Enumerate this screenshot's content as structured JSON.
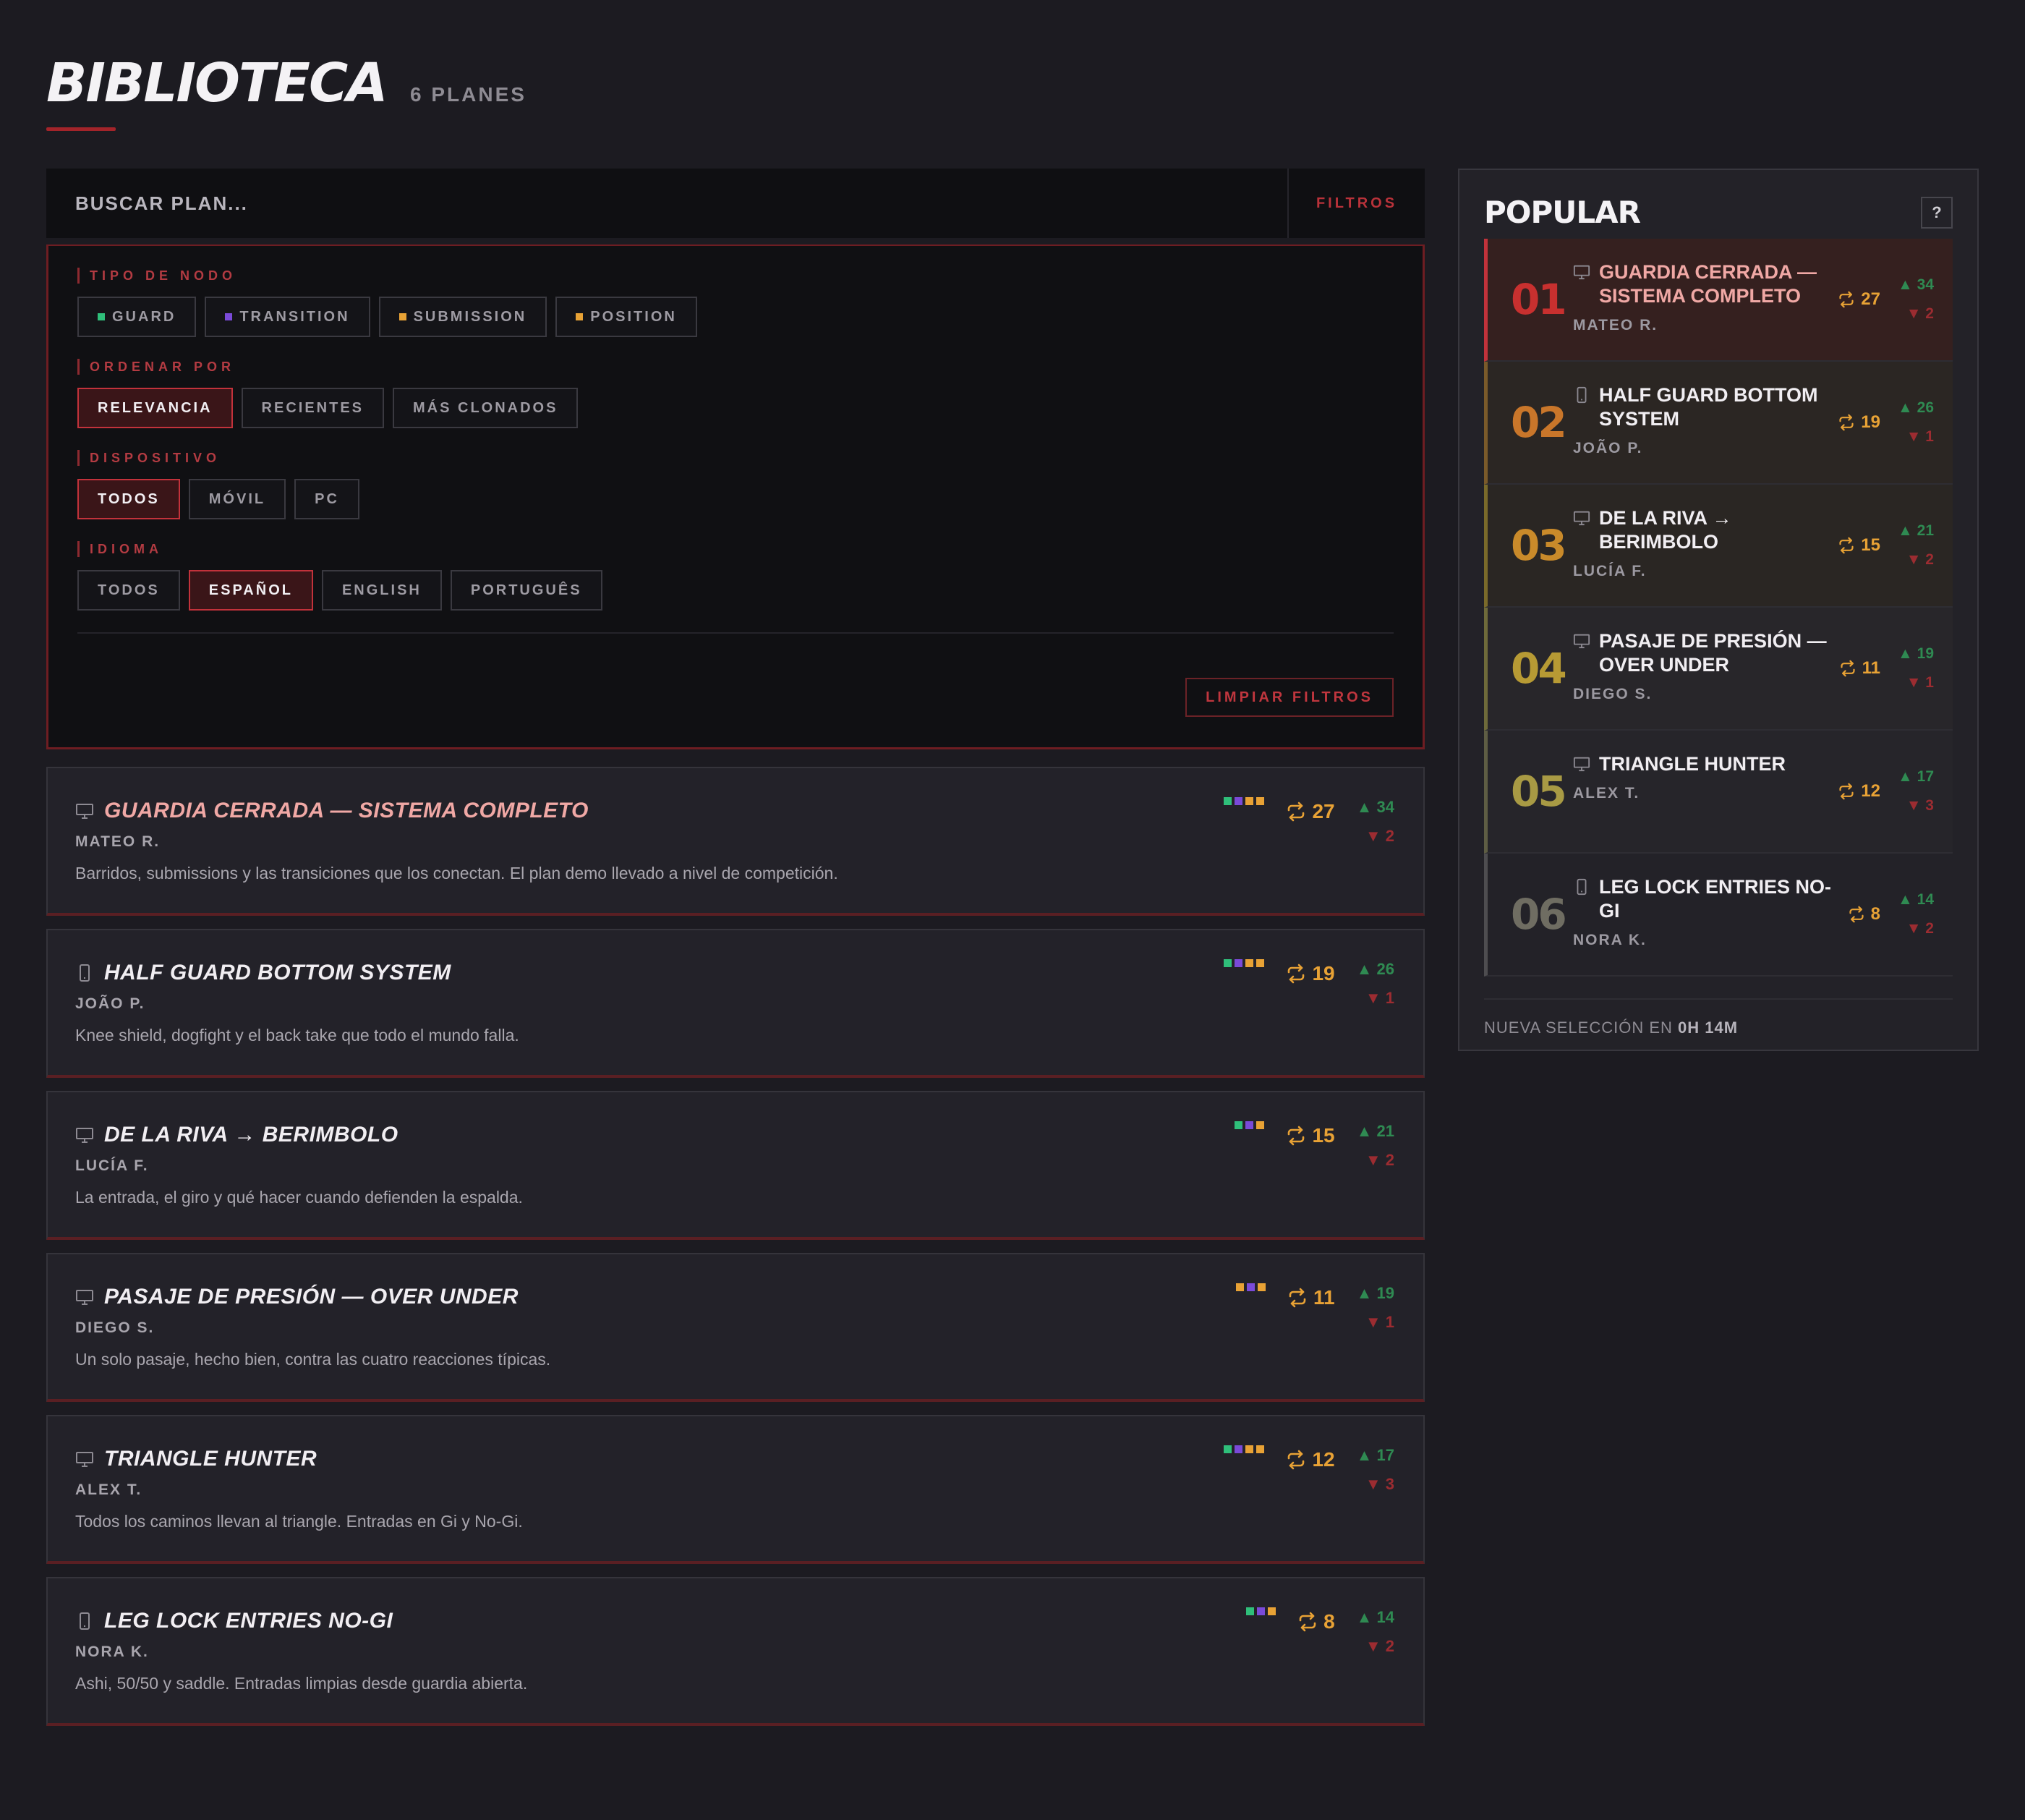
{
  "header": {
    "title": "BIBLIOTECA",
    "count": "6 PLANES"
  },
  "search": {
    "placeholder": "BUSCAR PLAN...",
    "filters_label": "FILTROS"
  },
  "filters": {
    "node_type": {
      "label": "TIPO DE NODO",
      "options": [
        {
          "label": "GUARD",
          "color": "#2fbf7a"
        },
        {
          "label": "TRANSITION",
          "color": "#7a4ad8"
        },
        {
          "label": "SUBMISSION",
          "color": "#e8a235"
        },
        {
          "label": "POSITION",
          "color": "#e8a235"
        }
      ]
    },
    "sort": {
      "label": "ORDENAR POR",
      "options": [
        "RELEVANCIA",
        "RECIENTES",
        "MÁS CLONADOS"
      ],
      "selected": "RELEVANCIA"
    },
    "device": {
      "label": "DISPOSITIVO",
      "options": [
        "TODOS",
        "MÓVIL",
        "PC"
      ],
      "selected": "TODOS"
    },
    "language": {
      "label": "IDIOMA",
      "options": [
        "TODOS",
        "ESPAÑOL",
        "ENGLISH",
        "PORTUGUÊS"
      ],
      "selected": "ESPAÑOL"
    },
    "clear_label": "LIMPIAR FILTROS"
  },
  "plans": [
    {
      "device": "pc",
      "title": "GUARDIA CERRADA — SISTEMA COMPLETO",
      "author": "MATEO R.",
      "desc": "Barridos, submissions y las transiciones que los conectan. El plan demo llevado a nivel de competición.",
      "types": [
        "#2fbf7a",
        "#7a4ad8",
        "#e8a235",
        "#e8a235"
      ],
      "clones": "27",
      "up": "▲ 34",
      "down": "▼ 2"
    },
    {
      "device": "mobile",
      "title": "HALF GUARD BOTTOM SYSTEM",
      "author": "JOÃO P.",
      "desc": "Knee shield, dogfight y el back take que todo el mundo falla.",
      "types": [
        "#2fbf7a",
        "#7a4ad8",
        "#e8a235",
        "#e8a235"
      ],
      "clones": "19",
      "up": "▲ 26",
      "down": "▼ 1"
    },
    {
      "device": "pc",
      "title": "DE LA RIVA → BERIMBOLO",
      "author": "LUCÍA F.",
      "desc": "La entrada, el giro y qué hacer cuando defienden la espalda.",
      "types": [
        "#2fbf7a",
        "#7a4ad8",
        "#e8a235"
      ],
      "clones": "15",
      "up": "▲ 21",
      "down": "▼ 2"
    },
    {
      "device": "pc",
      "title": "PASAJE DE PRESIÓN — OVER UNDER",
      "author": "DIEGO S.",
      "desc": "Un solo pasaje, hecho bien, contra las cuatro reacciones típicas.",
      "types": [
        "#e8a235",
        "#7a4ad8",
        "#e8a235"
      ],
      "clones": "11",
      "up": "▲ 19",
      "down": "▼ 1"
    },
    {
      "device": "pc",
      "title": "TRIANGLE HUNTER",
      "author": "ALEX T.",
      "desc": "Todos los caminos llevan al triangle. Entradas en Gi y No-Gi.",
      "types": [
        "#2fbf7a",
        "#7a4ad8",
        "#e8a235",
        "#e8a235"
      ],
      "clones": "12",
      "up": "▲ 17",
      "down": "▼ 3"
    },
    {
      "device": "mobile",
      "title": "LEG LOCK ENTRIES NO-GI",
      "author": "NORA K.",
      "desc": "Ashi, 50/50 y saddle. Entradas limpias desde guardia abierta.",
      "types": [
        "#2fbf7a",
        "#7a4ad8",
        "#e8a235"
      ],
      "clones": "8",
      "up": "▲ 14",
      "down": "▼ 2"
    }
  ],
  "popular": {
    "title": "POPULAR",
    "help": "?",
    "items": [
      {
        "rank": "01",
        "rank_color": "#c8302f",
        "device": "pc",
        "title": "GUARDIA CERRADA — SISTEMA COMPLETO",
        "author": "MATEO R.",
        "clones": "27",
        "up": "▲ 34",
        "down": "▼ 2"
      },
      {
        "rank": "02",
        "rank_color": "#c9762a",
        "device": "mobile",
        "title": "HALF GUARD BOTTOM SYSTEM",
        "author": "JOÃO P.",
        "clones": "19",
        "up": "▲ 26",
        "down": "▼ 1"
      },
      {
        "rank": "03",
        "rank_color": "#c98a2a",
        "device": "pc",
        "title": "DE LA RIVA → BERIMBOLO",
        "author": "LUCÍA F.",
        "clones": "15",
        "up": "▲ 21",
        "down": "▼ 2"
      },
      {
        "rank": "04",
        "rank_color": "#b79a34",
        "device": "pc",
        "title": "PASAJE DE PRESIÓN — OVER UNDER",
        "author": "DIEGO S.",
        "clones": "11",
        "up": "▲ 19",
        "down": "▼ 1"
      },
      {
        "rank": "05",
        "rank_color": "#a89a44",
        "device": "pc",
        "title": "TRIANGLE HUNTER",
        "author": "ALEX T.",
        "clones": "12",
        "up": "▲ 17",
        "down": "▼ 3"
      },
      {
        "rank": "06",
        "rank_color": "#6f6d62",
        "device": "mobile",
        "title": "LEG LOCK ENTRIES NO-GI",
        "author": "NORA K.",
        "clones": "8",
        "up": "▲ 14",
        "down": "▼ 2"
      }
    ],
    "footer_prefix": "NUEVA SELECCIÓN EN",
    "footer_time": "0H 14M"
  }
}
